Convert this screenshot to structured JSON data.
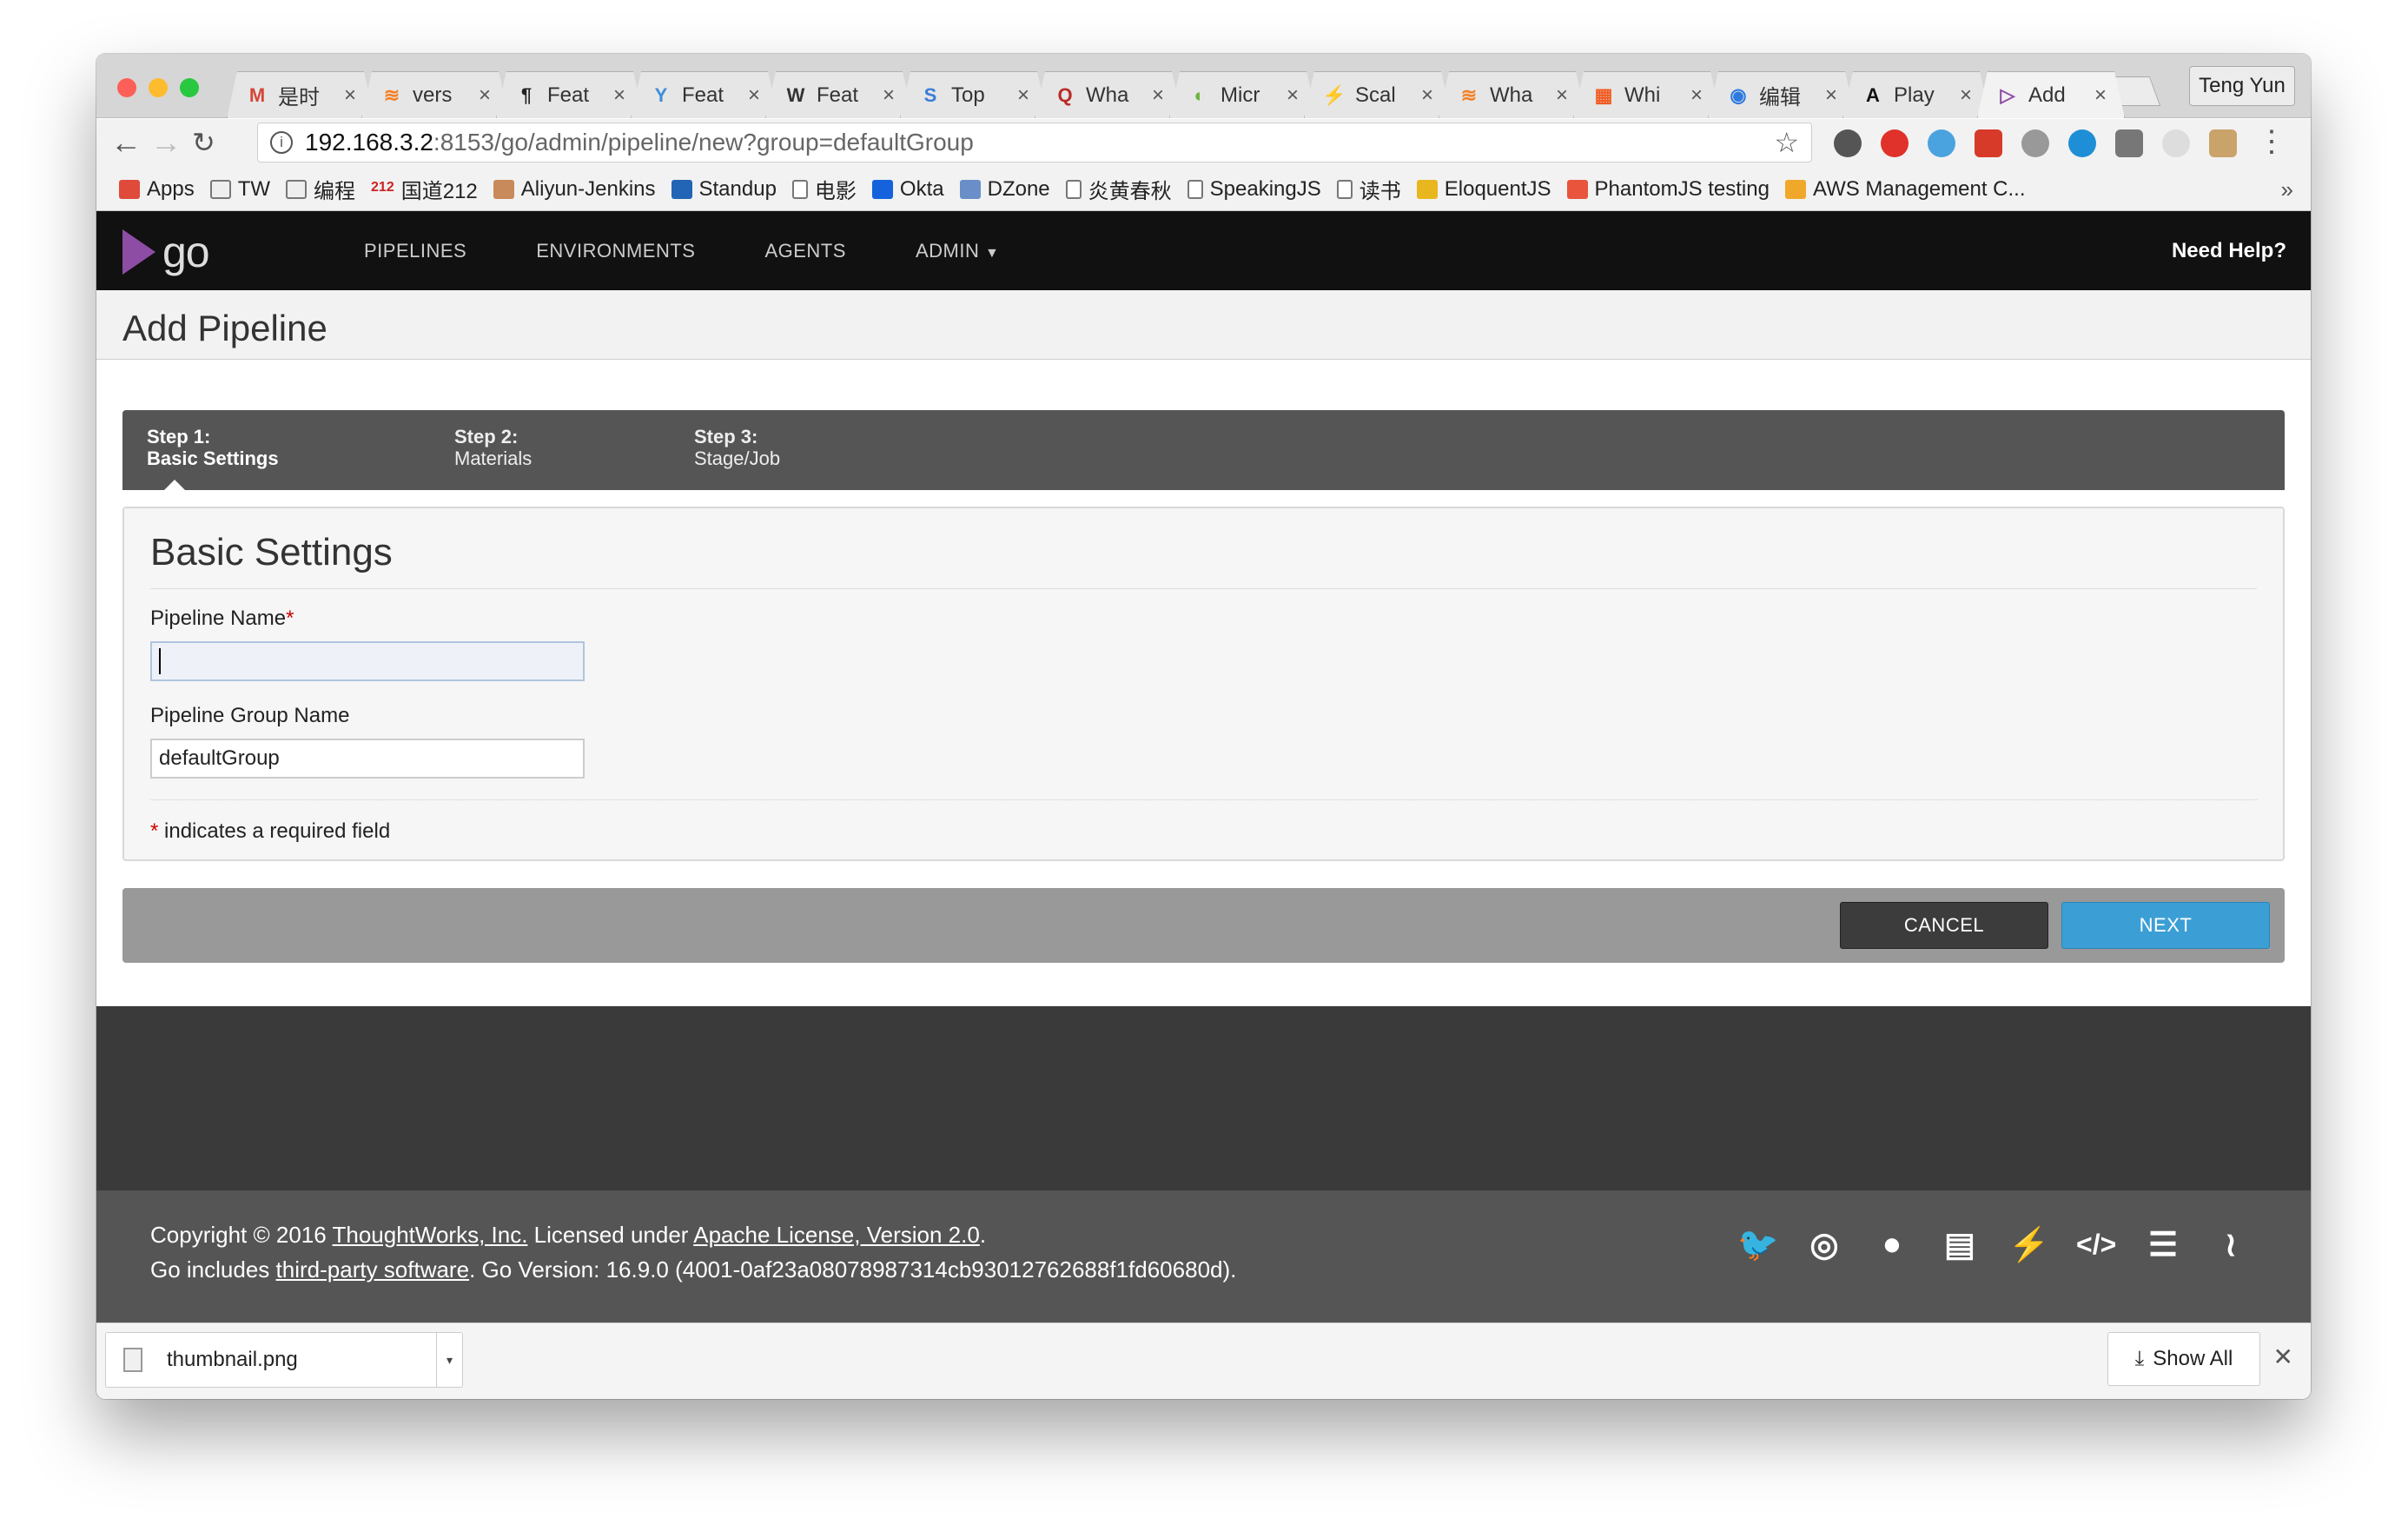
{
  "browser": {
    "tabs": [
      {
        "title": "是时",
        "icon": "gmail-icon",
        "color": "#d44638",
        "glyph": "M"
      },
      {
        "title": "vers",
        "icon": "stackoverflow-icon",
        "color": "#f48024",
        "glyph": "≋"
      },
      {
        "title": "Feat",
        "icon": "paragraph-icon",
        "color": "#222222",
        "glyph": "¶"
      },
      {
        "title": "Feat",
        "icon": "pivotal-icon",
        "color": "#3d8fd8",
        "glyph": "Y"
      },
      {
        "title": "Feat",
        "icon": "wikipedia-icon",
        "color": "#333333",
        "glyph": "W"
      },
      {
        "title": "Top",
        "icon": "swirl-icon",
        "color": "#3b7dd8",
        "glyph": "S"
      },
      {
        "title": "Wha",
        "icon": "quora-icon",
        "color": "#b92b27",
        "glyph": "Q"
      },
      {
        "title": "Micr",
        "icon": "spring-icon",
        "color": "#6db33f",
        "glyph": "◐"
      },
      {
        "title": "Scal",
        "icon": "scala-icon",
        "color": "#6a8ec8",
        "glyph": "⚡"
      },
      {
        "title": "Wha",
        "icon": "stackoverflow-icon",
        "color": "#f48024",
        "glyph": "≋"
      },
      {
        "title": "Whi",
        "icon": "grid-icon",
        "color": "#f15a22",
        "glyph": "▦"
      },
      {
        "title": "编辑",
        "icon": "app-icon",
        "color": "#2d7ae0",
        "glyph": "◉"
      },
      {
        "title": "Play",
        "icon": "angular-icon",
        "color": "#111111",
        "glyph": "A"
      },
      {
        "title": "Add",
        "icon": "go-icon",
        "color": "#8e4da4",
        "glyph": "▷"
      }
    ],
    "profile": "Teng Yun",
    "url_host": "192.168.3.2",
    "url_path": ":8153/go/admin/pipeline/new?group=defaultGroup",
    "bookmarks": [
      {
        "label": "Apps",
        "icon": "apps-grid-icon",
        "color": "#e04a3a"
      },
      {
        "label": "TW",
        "icon": "folder-icon",
        "color": "#999999"
      },
      {
        "label": "编程",
        "icon": "folder-icon",
        "color": "#999999"
      },
      {
        "label": "国道212",
        "icon": "road-sign-icon",
        "color": "#cc2222",
        "prefix": "212"
      },
      {
        "label": "Aliyun-Jenkins",
        "icon": "jenkins-icon",
        "color": "#c88a5a"
      },
      {
        "label": "Standup",
        "icon": "standup-icon",
        "color": "#2264b5"
      },
      {
        "label": "电影",
        "icon": "page-icon",
        "color": "#ffffff"
      },
      {
        "label": "Okta",
        "icon": "okta-icon",
        "color": "#1662dd"
      },
      {
        "label": "DZone",
        "icon": "dzone-icon",
        "color": "#6a8ec8"
      },
      {
        "label": "炎黄春秋",
        "icon": "page-icon",
        "color": "#ffffff"
      },
      {
        "label": "SpeakingJS",
        "icon": "page-icon",
        "color": "#ffffff"
      },
      {
        "label": "读书",
        "icon": "page-icon",
        "color": "#ffffff"
      },
      {
        "label": "EloquentJS",
        "icon": "ejs-icon",
        "color": "#e8b61e"
      },
      {
        "label": "PhantomJS testing",
        "icon": "plus-icon",
        "color": "#e8553c"
      },
      {
        "label": "AWS Management C...",
        "icon": "aws-box-icon",
        "color": "#f0a82a"
      }
    ],
    "download": {
      "filename": "thumbnail.png",
      "show_all": "Show All"
    }
  },
  "go": {
    "logo_text": "go",
    "nav": [
      "PIPELINES",
      "ENVIRONMENTS",
      "AGENTS",
      "ADMIN"
    ],
    "need_help": "Need Help?",
    "page_title": "Add Pipeline",
    "steps": [
      {
        "title": "Step 1:",
        "sub": "Basic Settings"
      },
      {
        "title": "Step 2:",
        "sub": "Materials"
      },
      {
        "title": "Step 3:",
        "sub": "Stage/Job"
      }
    ],
    "panel_title": "Basic Settings",
    "fields": {
      "pipeline_name_label": "Pipeline Name",
      "pipeline_name_value": "",
      "group_label": "Pipeline Group Name",
      "group_value": "defaultGroup",
      "required_note": " indicates a required field"
    },
    "buttons": {
      "cancel": "CANCEL",
      "next": "NEXT"
    },
    "footer": {
      "copyright_pre": "Copyright © 2016 ",
      "tw_link": "ThoughtWorks, Inc.",
      "licensed": " Licensed under ",
      "license_link": "Apache License, Version 2.0",
      "dot": ".",
      "includes_pre": "Go includes ",
      "third_party_link": "third-party software",
      "version_text": ". Go Version: 16.9.0 (4001-0af23a08078987314cb93012762688f1fd60680d)."
    }
  },
  "colors": {
    "accent": "#3b9fd6",
    "go_purple": "#8e4da4",
    "header_bg": "#111111"
  }
}
